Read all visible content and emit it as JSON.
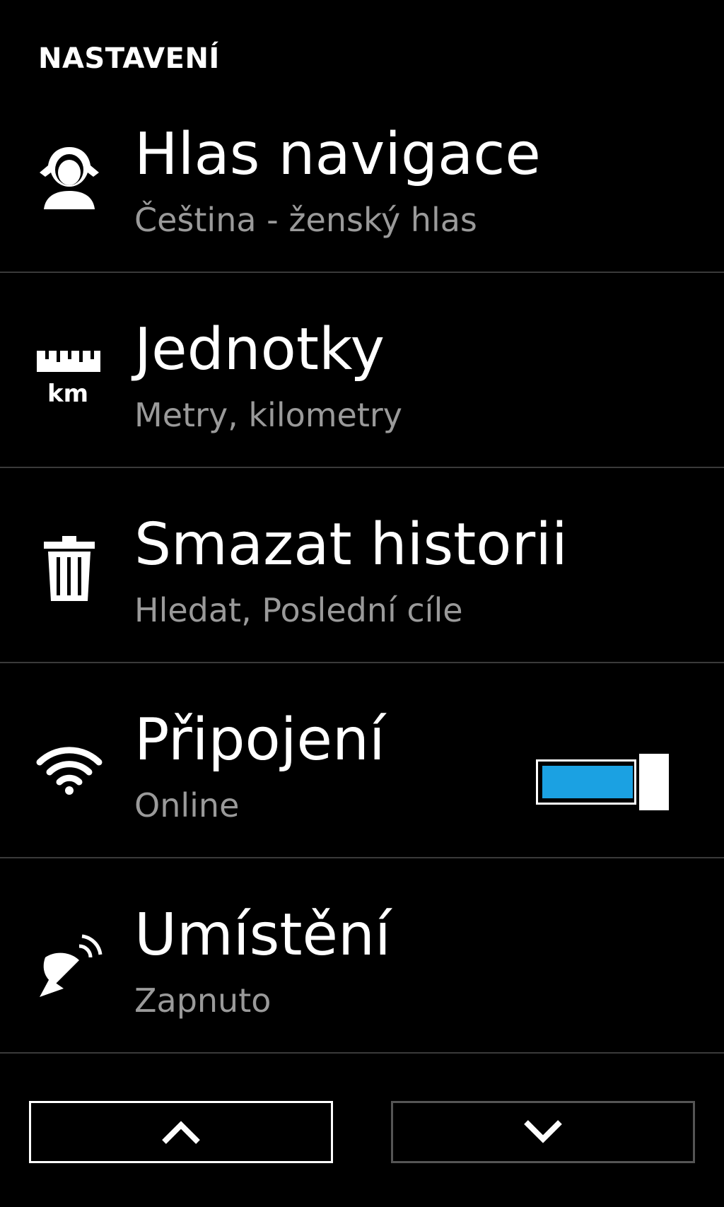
{
  "header": {
    "title": "NASTAVENÍ"
  },
  "settings": [
    {
      "icon": "woman-voice-icon",
      "title": "Hlas navigace",
      "subtitle": "Čeština - ženský hlas"
    },
    {
      "icon": "ruler-km-icon",
      "title": "Jednotky",
      "subtitle": "Metry, kilometry",
      "icon_text": "km"
    },
    {
      "icon": "trash-icon",
      "title": "Smazat historii",
      "subtitle": "Hledat, Poslední cíle"
    },
    {
      "icon": "wifi-icon",
      "title": "Připojení",
      "subtitle": "Online",
      "toggle_on": true
    },
    {
      "icon": "satellite-dish-icon",
      "title": "Umístění",
      "subtitle": "Zapnuto"
    }
  ],
  "navigation": {
    "up_icon": "chevron-up-icon",
    "down_icon": "chevron-down-icon"
  },
  "colors": {
    "background": "#000000",
    "text": "#ffffff",
    "subtitle": "#9a9a9a",
    "divider": "#3a3a3a",
    "accent": "#1ba1e2",
    "disabled_border": "#555555"
  }
}
